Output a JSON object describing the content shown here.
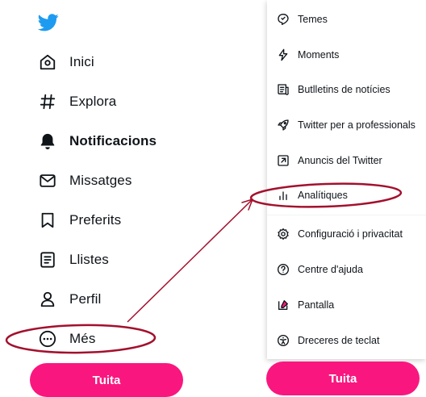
{
  "nav": {
    "items": [
      {
        "label": "Inici",
        "icon": "home-icon"
      },
      {
        "label": "Explora",
        "icon": "hashtag-icon"
      },
      {
        "label": "Notificacions",
        "icon": "bell-icon"
      },
      {
        "label": "Missatges",
        "icon": "envelope-icon"
      },
      {
        "label": "Preferits",
        "icon": "bookmark-icon"
      },
      {
        "label": "Llistes",
        "icon": "list-icon"
      },
      {
        "label": "Perfil",
        "icon": "person-icon"
      },
      {
        "label": "Més",
        "icon": "more-circle-icon"
      }
    ],
    "tweet_label": "Tuita"
  },
  "menu": {
    "items": [
      {
        "label": "Temes",
        "icon": "topics-icon"
      },
      {
        "label": "Moments",
        "icon": "lightning-icon"
      },
      {
        "label": "Butlletins de notícies",
        "icon": "newsletter-icon"
      },
      {
        "label": "Twitter per a professionals",
        "icon": "rocket-icon"
      },
      {
        "label": "Anuncis del Twitter",
        "icon": "external-arrow-icon"
      },
      {
        "label": "Analítiques",
        "icon": "bar-chart-icon"
      },
      {
        "label": "Configuració i privacitat",
        "icon": "gear-icon"
      },
      {
        "label": "Centre d'ajuda",
        "icon": "help-circle-icon"
      },
      {
        "label": "Pantalla",
        "icon": "display-pen-icon"
      },
      {
        "label": "Dreceres de teclat",
        "icon": "accessibility-icon"
      }
    ],
    "tweet_label": "Tuita"
  },
  "colors": {
    "brand_blue": "#1d9bf0",
    "tweet_pink": "#f9177f",
    "annotation_red": "#a3102d"
  }
}
